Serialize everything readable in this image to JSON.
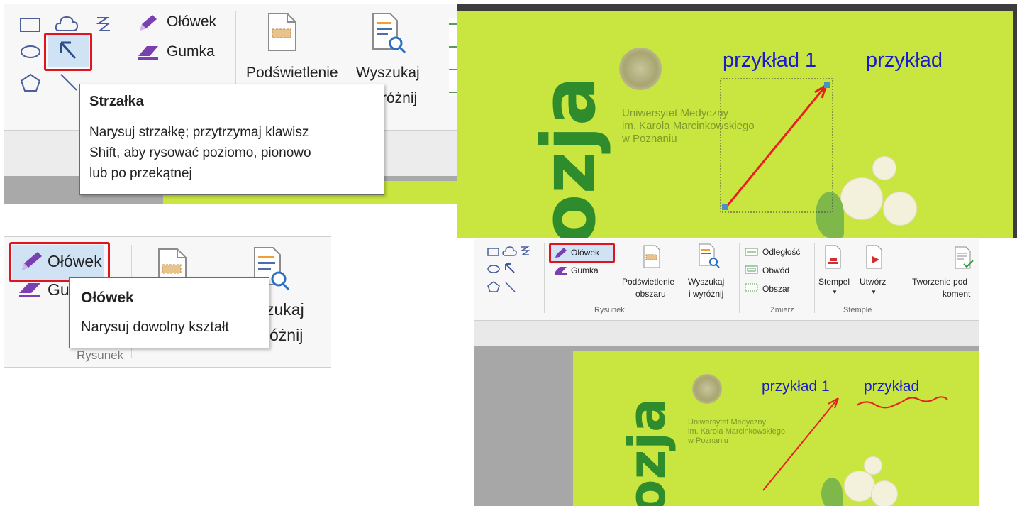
{
  "panel_a": {
    "tools": {
      "pencil": "Ołówek",
      "eraser": "Gumka",
      "highlight": "Podświetlenie",
      "search_partial": "Wyszukaj",
      "search_partial2": "różnij"
    },
    "tooltip": {
      "title": "Strzałka",
      "line1": "Narysuj strzałkę; przytrzymaj klawisz",
      "line2": "Shift, aby rysować poziomo, pionowo",
      "line3": "lub po przekątnej"
    }
  },
  "panel_b": {
    "label1": "przykład 1",
    "label2": "przykład",
    "university": {
      "line1": "Uniwersytet Medyczny",
      "line2": "im. Karola Marcinkowskiego",
      "line3": "w Poznaniu"
    },
    "cover_text": "ozja"
  },
  "panel_c": {
    "pencil": "Ołówek",
    "eraser_partial": "Gu",
    "search_partial": "zukaj",
    "search_partial2": "óżnij",
    "group_partial": "Rysunek",
    "tooltip": {
      "title": "Ołówek",
      "desc": "Narysuj dowolny kształt"
    }
  },
  "panel_d": {
    "tools": {
      "pencil": "Ołówek",
      "eraser": "Gumka",
      "highlight_line1": "Podświetlenie",
      "highlight_line2": "obszaru",
      "search_line1": "Wyszukaj",
      "search_line2": "i wyróżnij",
      "distance": "Odległość",
      "perimeter": "Obwód",
      "area": "Obszar",
      "stamp": "Stempel",
      "create": "Utwórz",
      "comments_line1": "Tworzenie pod",
      "comments_line2": "koment"
    },
    "groups": {
      "drawing": "Rysunek",
      "measure": "Zmierz",
      "stamps": "Stemple"
    },
    "doc": {
      "label1": "przykład 1",
      "label2": "przykład",
      "uni1": "Uniwersytet Medyczny",
      "uni2": "im. Karola Marcinkowskiego",
      "uni3": "w Poznaniu",
      "cover_text": "ozja"
    }
  },
  "colors": {
    "highlight_red": "#e0141e",
    "document_green": "#c9e53f",
    "annotation_blue": "#1a1ad0",
    "pencil_purple": "#7a3fb0"
  }
}
